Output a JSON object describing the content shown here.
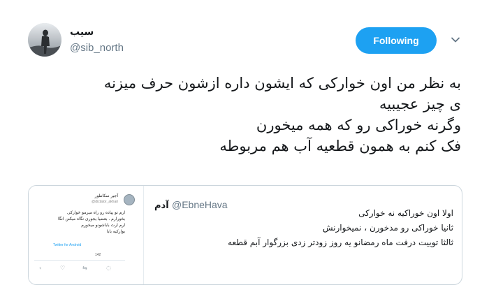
{
  "user": {
    "name": "سیب",
    "handle": "@sib_north"
  },
  "follow_button": {
    "label": "Following",
    "color": "#1da1f2"
  },
  "tweet": {
    "lines": [
      "به نظر من اون خوارکی که ایشون داره ازشون حرف میزنه",
      "ی چیز عجیبیه",
      "وگرنه خوراکی رو که همه میخورن",
      "فک کنم به همون قطعیه آب هم مربوطه"
    ]
  },
  "quoted_tweet": {
    "name": "آدم",
    "handle": "@EbneHava",
    "lines": [
      "اولا اون خوراکیه نه خوارکی",
      "ثانیا خوراکی رو مدخورن ، نمیخوارنش",
      "ثالثا توییت درفت ماه رمضانو یه روز زودتر زدی بزرگوار آبم قطعه"
    ],
    "screenshot": {
      "name": "آجیر سکاطور",
      "handle": "@dictator_akhari",
      "lines": [
        "ارم تو پیاده رو راه میرمو خوارکی",
        "بخورارم . بعضیا یجوری نگاه میکنن انگا",
        "ارم ارث باباشونو میخورم",
        "بوارکیه بابا"
      ],
      "source": "Twitter for Android",
      "likes": "142"
    }
  },
  "icons": {
    "chevron": "chevron-down-icon",
    "reply": "reply-icon",
    "retweet": "retweet-icon",
    "like": "heart-icon",
    "share": "share-icon"
  }
}
